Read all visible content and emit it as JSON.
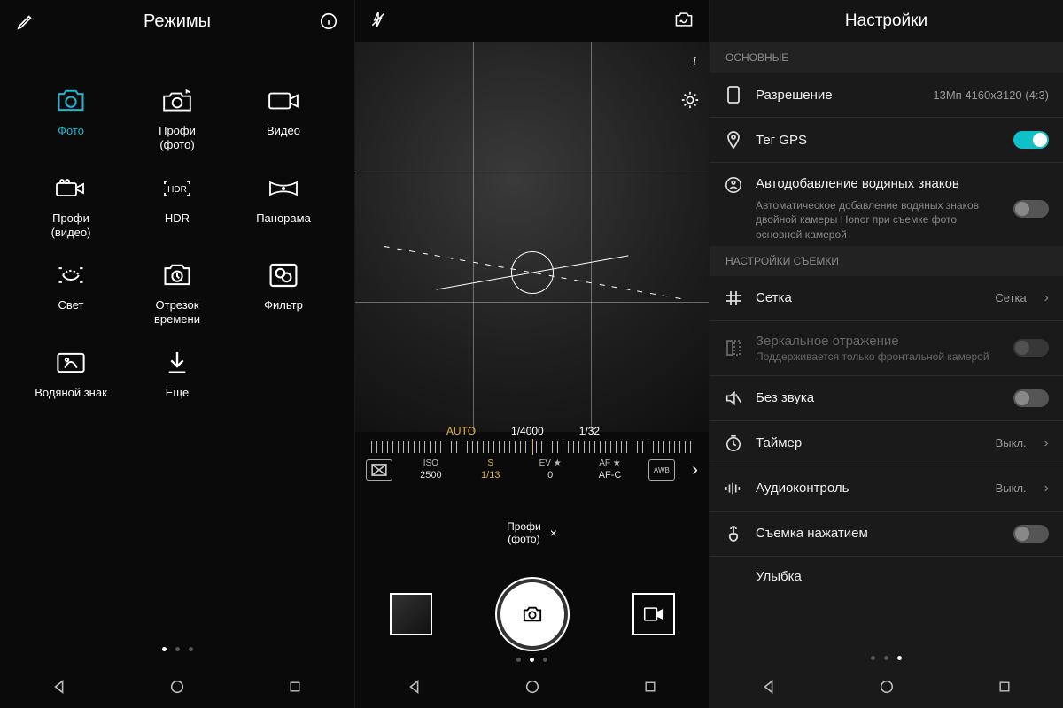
{
  "panel1": {
    "title": "Режимы",
    "modes": [
      {
        "label": "Фото",
        "active": true,
        "icon": "camera"
      },
      {
        "label": "Профи\n(фото)",
        "icon": "pro-camera"
      },
      {
        "label": "Видео",
        "icon": "video"
      },
      {
        "label": "Профи\n(видео)",
        "icon": "pro-video"
      },
      {
        "label": "HDR",
        "icon": "hdr"
      },
      {
        "label": "Панорама",
        "icon": "panorama"
      },
      {
        "label": "Свет",
        "icon": "light"
      },
      {
        "label": "Отрезок\nвремени",
        "icon": "timelapse"
      },
      {
        "label": "Фильтр",
        "icon": "filter"
      },
      {
        "label": "Водяной знак",
        "icon": "watermark"
      },
      {
        "label": "Еще",
        "icon": "more"
      }
    ]
  },
  "panel2": {
    "readout": {
      "auto": "AUTO",
      "shutter_fast": "1/4000",
      "aperture": "1/32"
    },
    "pro": {
      "iso": {
        "lbl": "ISO",
        "val": "2500"
      },
      "s": {
        "lbl": "S",
        "val": "1/13"
      },
      "ev": {
        "lbl": "EV ★",
        "val": "0"
      },
      "af": {
        "lbl": "AF ★",
        "val": "AF-C"
      },
      "awb": "AWB"
    },
    "badge": "Профи\n(фото)"
  },
  "panel3": {
    "title": "Настройки",
    "sections": {
      "basic": "ОСНОВНЫЕ",
      "shoot": "НАСТРОЙКИ СЪЕМКИ"
    },
    "rows": {
      "resolution": {
        "label": "Разрешение",
        "value": "13Мп 4160x3120 (4:3)"
      },
      "gps": {
        "label": "Тег GPS",
        "on": true
      },
      "watermark": {
        "title": "Автодобавление водяных знаков",
        "text": "Автоматическое добавление водяных знаков двойной камеры Honor при съемке фото основной камерой",
        "on": false
      },
      "grid": {
        "label": "Сетка",
        "value": "Сетка"
      },
      "mirror": {
        "label": "Зеркальное отражение",
        "text": "Поддерживается только фронтальной камерой",
        "disabled": true
      },
      "mute": {
        "label": "Без звука",
        "on": false
      },
      "timer": {
        "label": "Таймер",
        "value": "Выкл."
      },
      "audio": {
        "label": "Аудиоконтроль",
        "value": "Выкл."
      },
      "touch": {
        "label": "Съемка нажатием",
        "on": false
      },
      "smile": {
        "label": "Улыбка"
      }
    }
  }
}
